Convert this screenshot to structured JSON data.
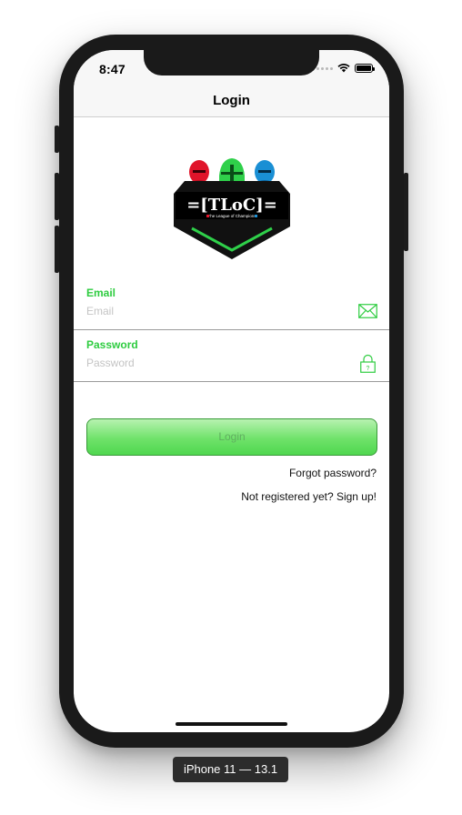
{
  "status_bar": {
    "time": "8:47"
  },
  "navbar": {
    "title": "Login"
  },
  "logo": {
    "text": "=[TLoC]=",
    "tagline": "The League of Champions"
  },
  "form": {
    "email": {
      "label": "Email",
      "placeholder": "Email",
      "value": "",
      "icon": "envelope-icon"
    },
    "password": {
      "label": "Password",
      "placeholder": "Password",
      "value": "",
      "icon": "padlock-icon"
    },
    "login_label": "Login",
    "forgot_label": "Forgot password?",
    "signup_label": "Not registered yet? Sign up!"
  },
  "device_caption": "iPhone 11 — 13.1",
  "colors": {
    "accent": "#2ecc40",
    "button_top": "#b7f2b0",
    "button_bottom": "#4fd74f"
  }
}
